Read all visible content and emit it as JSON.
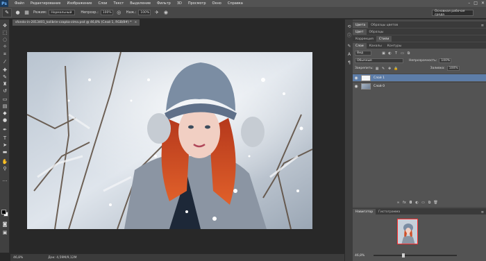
{
  "app": {
    "logo": "Ps"
  },
  "menu": [
    "Файл",
    "Редактирование",
    "Изображение",
    "Слои",
    "Текст",
    "Выделение",
    "Фильтр",
    "3D",
    "Просмотр",
    "Окно",
    "Справка"
  ],
  "window_controls": [
    "–",
    "□",
    "✕"
  ],
  "options_bar": {
    "mode_label": "Режим:",
    "mode_value": "Нормальный",
    "opacity_label": "Непрозр.:",
    "opacity_value": "100%",
    "flow_label": "Наж.:",
    "flow_value": "100%",
    "workspace": "Основная рабочая среда"
  },
  "document": {
    "tab_title": "sfondo-in-2013401_kolibrie-czapka-zima.psd @ 46,8% (Слой 1, RGB/8#) *",
    "close": "×",
    "zoom": "46,8%",
    "doc_size": "Док: 4,59M/9,12M"
  },
  "right_panels": {
    "top_tabs": [
      {
        "label": "Цвета",
        "active": true
      },
      {
        "label": "Образцы цветов",
        "active": false
      }
    ],
    "second_tabs": [
      {
        "label": "Цвет",
        "active": true
      },
      {
        "label": "Образцы",
        "active": false
      }
    ],
    "adjust_tabs": [
      {
        "label": "Коррекция",
        "active": false
      },
      {
        "label": "Стили",
        "active": true
      }
    ],
    "layers_tabs": [
      {
        "label": "Слои",
        "active": true
      },
      {
        "label": "Каналы",
        "active": false
      },
      {
        "label": "Контуры",
        "active": false
      }
    ],
    "kind_filter": "Вид",
    "blend_mode": "Обычные",
    "opacity_label": "Непрозрачность:",
    "opacity_value": "100%",
    "lock_label": "Закрепить:",
    "fill_label": "Заливка:",
    "fill_value": "100%",
    "layers": [
      {
        "name": "Слой 1",
        "selected": true
      },
      {
        "name": "Слой 0",
        "selected": false
      }
    ],
    "navigator_tabs": [
      {
        "label": "Навигатор",
        "active": true
      },
      {
        "label": "Гистограмма",
        "active": false
      }
    ],
    "navigator_zoom": "46,8%",
    "navigator_slider_level": 0.35
  },
  "colors": {
    "menubar": "#535353",
    "canvas_bg": "#282828",
    "layer_selected": "#5d7da8",
    "navigator_frame": "#ff3030"
  }
}
